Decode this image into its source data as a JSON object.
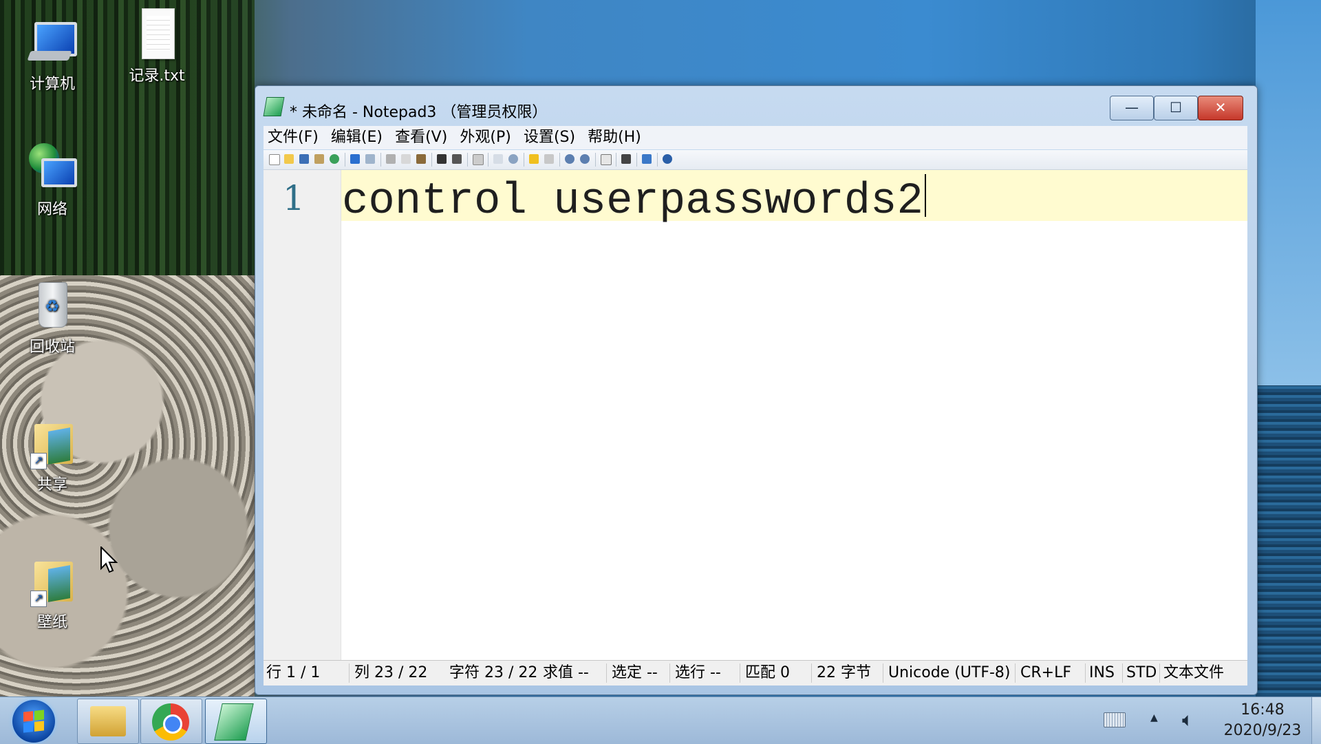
{
  "desktop": {
    "icons": [
      {
        "label": "计算机",
        "icon": "computer-icon"
      },
      {
        "label": "记录.txt",
        "icon": "text-file-icon"
      },
      {
        "label": "网络",
        "icon": "network-icon"
      },
      {
        "label": "回收站",
        "icon": "recycle-bin-icon"
      },
      {
        "label": "共享",
        "icon": "folder-shortcut-icon"
      },
      {
        "label": "壁纸",
        "icon": "folder-shortcut-icon"
      }
    ]
  },
  "window": {
    "title": "* 未命名 - Notepad3 （管理员权限）",
    "buttons": {
      "minimize": "—",
      "maximize": "☐",
      "close": "✕"
    },
    "menu": [
      "文件(F)",
      "编辑(E)",
      "查看(V)",
      "外观(P)",
      "设置(S)",
      "帮助(H)"
    ],
    "editor": {
      "line_number": "1",
      "text": "control userpasswords2"
    },
    "status": {
      "line": "行 1 / 1",
      "column": "列 23 / 22",
      "chars": "字符 23 / 22",
      "eval": "求值 --",
      "selected": "选定 --",
      "selected_lines": "选行 --",
      "matches": "匹配 0",
      "bytes": "22 字节",
      "encoding": "Unicode (UTF-8)",
      "eol": "CR+LF",
      "ins": "INS",
      "std": "STD",
      "lexer": "文本文件"
    }
  },
  "taskbar": {
    "time": "16:48",
    "date": "2020/9/23"
  },
  "colors": {
    "current_line": "#fffbd0",
    "line_number": "#2f6f88",
    "close_button": "#c5372a"
  }
}
